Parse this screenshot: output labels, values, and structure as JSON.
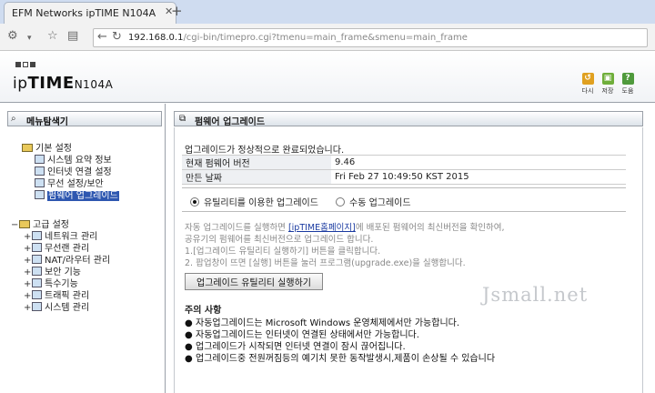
{
  "browser": {
    "tab_title": "EFM Networks ipTIME N104A",
    "tab_close": "✕",
    "new_tab": "+",
    "url_host": "192.168.0.1",
    "url_path": "/cgi-bin/timepro.cgi?tmenu=main_frame&smenu=main_frame"
  },
  "header": {
    "brand_prefix": "ip",
    "brand_main": "TIME",
    "brand_model": "N104A",
    "buttons": [
      {
        "label": "다시",
        "color": "#e0a020",
        "glyph": "↺"
      },
      {
        "label": "저장",
        "color": "#6fae3a",
        "glyph": "▣"
      },
      {
        "label": "도움",
        "color": "#4f9a3c",
        "glyph": "?"
      }
    ]
  },
  "left_panel": {
    "title": "메뉴탐색기",
    "basic_group": "기본 설정",
    "basic_items": [
      "시스템 요약 정보",
      "인터넷 연결 설정",
      "무선 설정/보안",
      "펌웨어 업그레이드"
    ],
    "advanced_group": "고급 설정",
    "advanced_items": [
      "네트워크 관리",
      "무선랜 관리",
      "NAT/라우터 관리",
      "보안 기능",
      "특수기능",
      "트래픽 관리",
      "시스템 관리"
    ]
  },
  "main": {
    "title": "펌웨어 업그레이드",
    "status_message": "업그레이드가 정상적으로 완료되었습니다.",
    "info": [
      {
        "key": "현재 펌웨어 버전",
        "value": "9.46"
      },
      {
        "key": "만든 날짜",
        "value": "Fri Feb 27 10:49:50 KST 2015"
      }
    ],
    "radio_utility": "유틸리티를 이용한 업그레이드",
    "radio_manual": "수동 업그레이드",
    "desc_line1_pre": "자동 업그레이드를 실행하면",
    "desc_link": "[ipTIME홈페이지]",
    "desc_line1_post": "에 배포된 펌웨어의 최신버전을 확인하여,",
    "desc_line2": "공유기의 펌웨어를 최신버전으로 업그레이드 합니다.",
    "desc_line3": "1.[업그레이드 유틸리티 실행하기] 버튼을 클릭합니다.",
    "desc_line4": "2. 팝업창이 뜨면 [실행] 버튼을 눌러 프로그램(upgrade.exe)을 실행합니다.",
    "run_button": "업그레이드 유틸리티 실행하기",
    "notes_title": "주의 사항",
    "notes": [
      "자동업그레이드는 Microsoft Windows 운영체제에서만 가능합니다.",
      "자동업그레이드는 인터넷이 연결된 상태에서만 가능합니다.",
      "업그레이드가 시작되면 인터넷 연결이 잠시 끊어집니다.",
      "업그레이드중 전원꺼짐등의 예기치 못한 동작발생시,제품이 손상될 수 있습니다"
    ]
  },
  "watermark": "Jsmall.net"
}
